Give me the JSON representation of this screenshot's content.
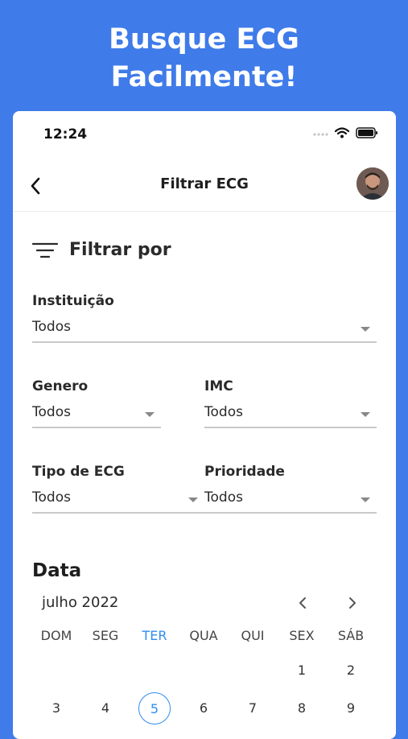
{
  "headline": {
    "line1": "Busque ECG",
    "line2": "Facilmente!"
  },
  "status_bar": {
    "time": "12:24",
    "icons": [
      "cellular-icon",
      "wifi-icon",
      "battery-icon"
    ]
  },
  "header": {
    "title": "Filtrar ECG",
    "back_icon": "chevron-left-icon",
    "avatar": "avatar"
  },
  "filter": {
    "heading": "Filtrar por",
    "icon": "filter-lines-icon",
    "instituicao": {
      "label": "Instituição",
      "value": "Todos"
    },
    "genero": {
      "label": "Genero",
      "value": "Todos"
    },
    "imc": {
      "label": "IMC",
      "value": "Todos"
    },
    "tipo_ecg": {
      "label": "Tipo de ECG",
      "value": "Todos"
    },
    "prioridade": {
      "label": "Prioridade",
      "value": "Todos"
    }
  },
  "calendar": {
    "title": "Data",
    "month": "julho 2022",
    "weekdays": [
      "DOM",
      "SEG",
      "TER",
      "QUA",
      "QUI",
      "SEX",
      "SÁB"
    ],
    "today_weekday": "TER",
    "weeks": [
      [
        "",
        "",
        "",
        "",
        "",
        "1",
        "2"
      ],
      [
        "3",
        "4",
        "5",
        "6",
        "7",
        "8",
        "9"
      ]
    ],
    "selected_day": "5"
  },
  "colors": {
    "background": "#3f7be9",
    "accent": "#2f8ef0"
  }
}
